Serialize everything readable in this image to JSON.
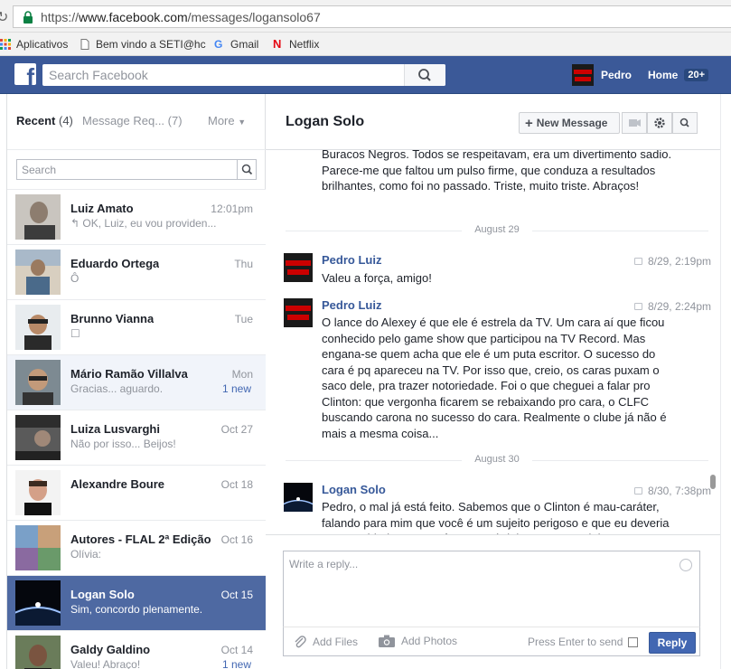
{
  "browser": {
    "url_prefix": "https://",
    "url_domain": "www.facebook.com",
    "url_path": "/messages/logansolo67",
    "bookmarks": [
      "Aplicativos",
      "Bem vindo a SETI@hc",
      "Gmail",
      "Netflix"
    ]
  },
  "fb": {
    "search_placeholder": "Search Facebook",
    "user_name": "Pedro",
    "home_label": "Home",
    "home_badge": "20+"
  },
  "left": {
    "tab_recent": "Recent",
    "tab_recent_count": "(4)",
    "tab_requests": "Message Req... (7)",
    "tab_more": "More",
    "search_placeholder": "Search",
    "threads": [
      {
        "name": "Luiz Amato",
        "snippet": "↰ OK, Luiz, eu vou providen...",
        "time": "12:01pm",
        "new": ""
      },
      {
        "name": "Eduardo Ortega",
        "snippet": "Ô",
        "time": "Thu",
        "new": ""
      },
      {
        "name": "Brunno Vianna",
        "snippet": "☐",
        "time": "Tue",
        "new": ""
      },
      {
        "name": "Mário Ramão Villalva",
        "snippet": "Gracias... aguardo.",
        "time": "Mon",
        "new": "1 new"
      },
      {
        "name": "Luiza Lusvarghi",
        "snippet": "Não por isso... Beijos!",
        "time": "Oct 27",
        "new": ""
      },
      {
        "name": "Alexandre Boure",
        "snippet": "",
        "time": "Oct 18",
        "new": ""
      },
      {
        "name": "Autores - FLAL 2ª Edição",
        "snippet": "Olívia:",
        "time": "Oct 16",
        "new": ""
      },
      {
        "name": "Logan Solo",
        "snippet": "Sim, concordo plenamente.",
        "time": "Oct 15",
        "new": ""
      },
      {
        "name": "Galdy Galdino",
        "snippet": "Valeu! Abraço!",
        "time": "Oct 14",
        "new": "1 new"
      }
    ]
  },
  "conversation": {
    "title": "Logan Solo",
    "new_message_label": "New Message",
    "messages_top_text": "Buracos Negros. Todos se respeitavam, era um divertimento sadio. Parece-me que faltou um pulso firme, que conduza a resultados brilhantes, como foi no passado. Triste, muito triste. Abraços!",
    "date_1": "August 29",
    "msg1_name": "Pedro Luiz",
    "msg1_time": "8/29, 2:19pm",
    "msg1_text": "Valeu a força, amigo!",
    "msg2_name": "Pedro Luiz",
    "msg2_time": "8/29, 2:24pm",
    "msg2_text": "O lance do Alexey é que ele é estrela da TV. Um cara aí que ficou conhecido pelo game show que participou na TV Record. Mas engana-se  quem acha que ele é um puta escritor. O sucesso do cara é pq apareceu na TV. Por isso que, creio, os caras puxam o saco dele, pra trazer notoriedade. Foi o que cheguei a falar pro Clinton: que vergonha ficarem se rebaixando pro cara, o CLFC buscando carona no sucesso do cara. Realmente o clube já não é mais a mesma coisa...",
    "date_2": "August 30",
    "msg3_name": "Logan Solo",
    "msg3_time": "8/30, 7:38pm",
    "msg3_text": "Pedro, o mal já está feito. Sabemos que o Clinton é mau-caráter, falando para mim que você é um sujeito perigoso e que eu deveria tomar cuidado com você. Agora, é deixar esses carinhas"
  },
  "composer": {
    "placeholder": "Write a reply...",
    "add_files": "Add Files",
    "add_photos": "Add Photos",
    "press_enter": "Press Enter to send",
    "reply_button": "Reply"
  },
  "colors": {
    "fb_blue": "#3b5998",
    "active_thread": "#4e69a2",
    "link_blue": "#365899",
    "reply_button": "#4267b2"
  }
}
